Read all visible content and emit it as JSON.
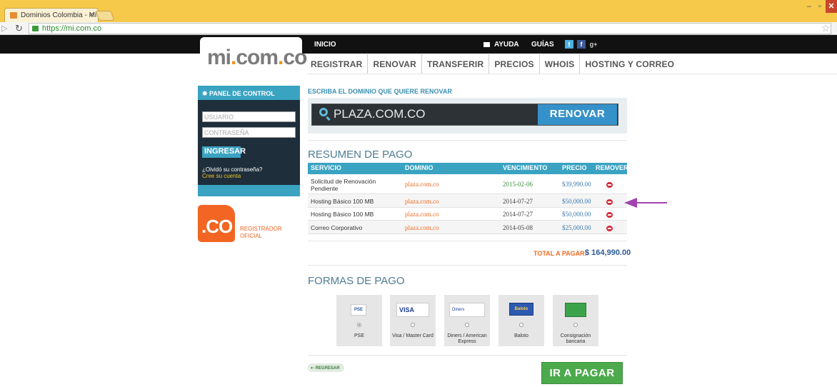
{
  "browser": {
    "tab_title": "Dominios Colombia - Mi",
    "tab_close": "×",
    "url": "https://mi.com.co",
    "min": "–",
    "max": "▫",
    "close": "✕"
  },
  "header": {
    "logo_main": "mi",
    "logo_dot1": ".",
    "logo_com": "com",
    "logo_dot2": ".",
    "logo_co": "co",
    "top_links": {
      "inicio": "INICIO",
      "ayuda": "AYUDA",
      "guias": "GUÍAS"
    },
    "social": {
      "twitter": "t",
      "facebook": "f",
      "google": "g+"
    },
    "nav": [
      "REGISTRAR",
      "RENOVAR",
      "TRANSFERIR",
      "PRECIOS",
      "WHOIS",
      "HOSTING Y CORREO"
    ]
  },
  "panel": {
    "title": "PANEL DE CONTROL",
    "user_placeholder": "USUARIO",
    "pass_placeholder": "CONTRASEÑA",
    "login": "INGRESAR",
    "forgot": "¿Olvidó su contraseña?",
    "create": "Cree su cuenta",
    "co_logo": ".CO",
    "registrador_1": "REGISTRADOR",
    "registrador_2": "OFICIAL"
  },
  "search": {
    "label": "ESCRIBA EL DOMINIO QUE QUIERE RENOVAR",
    "value": "PLAZA.COM.CO",
    "button": "RENOVAR"
  },
  "summary": {
    "title": "RESUMEN DE PAGO",
    "columns": [
      "SERVICIO",
      "DOMINIO",
      "VENCIMIENTO",
      "PRECIO",
      "REMOVER"
    ],
    "rows": [
      {
        "service": "Solicitud de Renovación Pendiente",
        "domain": "plaza.com.co",
        "date": "2015-02-06",
        "price": "$39,990.00"
      },
      {
        "service": "Hosting Básico 100 MB",
        "domain": "plaza.com.co",
        "date": "2014-07-27",
        "price": "$50,000.00"
      },
      {
        "service": "Hosting Básico 100 MB",
        "domain": "plaza.com.co",
        "date": "2014-07-27",
        "price": "$50,000.00"
      },
      {
        "service": "Correo Corporativo",
        "domain": "plaza.com.co",
        "date": "2014-05-08",
        "price": "$25,000.00"
      }
    ],
    "total_label": "TOTAL A PAGAR:",
    "total_value": "$ 164,990.00",
    "highlight_color": "#a244b0"
  },
  "payment": {
    "title": "FORMAS DE PAGO",
    "options": [
      {
        "label": "PSE",
        "logo": "PSE",
        "selected": true
      },
      {
        "label": "Visa / Master Card",
        "logo": "VISA",
        "selected": false
      },
      {
        "label": "Diners / American Express",
        "logo": "Diners",
        "selected": false
      },
      {
        "label": "Baloto",
        "logo": "Baloto",
        "selected": false
      },
      {
        "label": "Consignación bancaria",
        "logo": "bank",
        "selected": false
      }
    ],
    "back": "REGRESAR",
    "pay": "IR A PAGAR"
  }
}
